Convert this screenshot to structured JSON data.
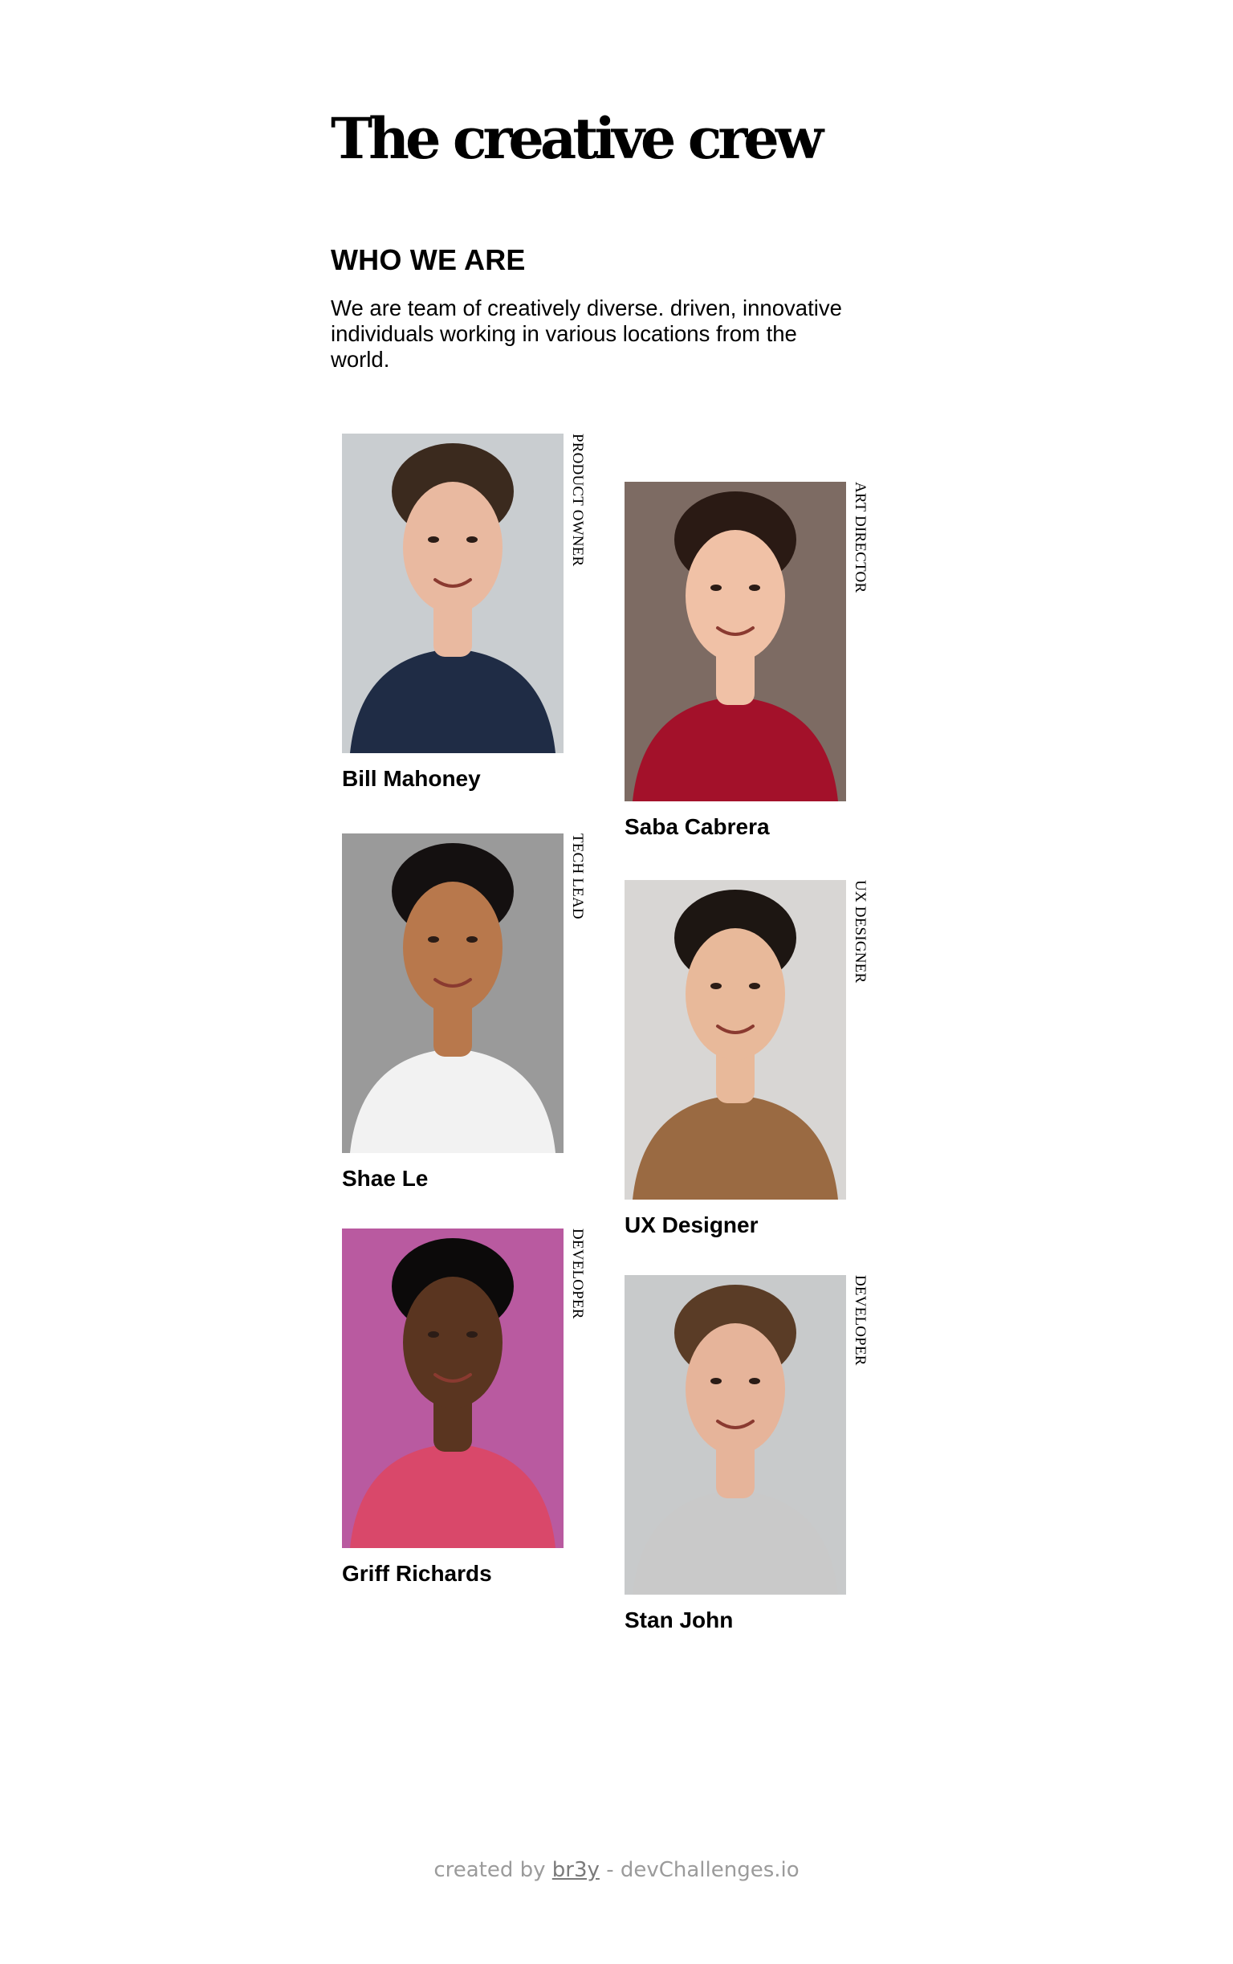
{
  "header": {
    "title": "The creative crew"
  },
  "about": {
    "heading": "WHO WE ARE",
    "text": "We are team of creatively diverse. driven, innovative individuals working in various locations from the world."
  },
  "members": [
    {
      "name": "Bill Mahoney",
      "role": "PRODUCT OWNER",
      "bg": "#c9cdd0",
      "skin": "#e9b9a0",
      "hair": "#3b2a1e",
      "shirt": "#1f2c45"
    },
    {
      "name": "Saba Cabrera",
      "role": "ART DIRECTOR",
      "bg": "#7d6b63",
      "skin": "#f0c1a6",
      "hair": "#2a1a14",
      "shirt": "#a3112a"
    },
    {
      "name": "Shae Le",
      "role": "TECH LEAD",
      "bg": "#9a9a9a",
      "skin": "#b8784c",
      "hair": "#141010",
      "shirt": "#f2f2f2"
    },
    {
      "name": "UX Designer",
      "role": "UX DESIGNER",
      "bg": "#d8d6d4",
      "skin": "#e8b99a",
      "hair": "#1d1612",
      "shirt": "#9a6a42"
    },
    {
      "name": "Griff Richards",
      "role": "DEVELOPER",
      "bg": "#b95aa0",
      "skin": "#5a3520",
      "hair": "#0c0a0a",
      "shirt": "#d9486a"
    },
    {
      "name": "Stan John",
      "role": "DEVELOPER",
      "bg": "#c8cacb",
      "skin": "#e6b49a",
      "hair": "#5a3c26",
      "shirt": "#c9c9c9"
    }
  ],
  "footer": {
    "prefix": "created by",
    "author": "br3y",
    "suffix": "- devChallenges.io"
  }
}
